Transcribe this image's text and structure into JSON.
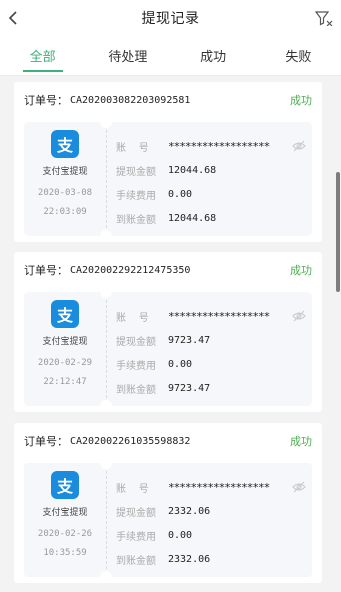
{
  "header": {
    "title": "提现记录"
  },
  "tabs": [
    {
      "label": "全部"
    },
    {
      "label": "待处理"
    },
    {
      "label": "成功"
    },
    {
      "label": "失败"
    }
  ],
  "active_tab": "全部",
  "colors": {
    "accent": "#3fb07a",
    "success": "#4caf50",
    "alipay": "#1a8cde"
  },
  "labels": {
    "order": "订单号：",
    "account": "账    号",
    "amount": "提现金额",
    "fee": "手续费用",
    "received": "到账金额"
  },
  "records": [
    {
      "order_no": "CA202003082203092581",
      "status": "成功",
      "method": "支付宝提现",
      "method_icon": "支",
      "date": "2020-03-08",
      "time": "22:03:09",
      "account": "******************",
      "amount": "12044.68",
      "fee": "0.00",
      "received": "12044.68"
    },
    {
      "order_no": "CA202002292212475350",
      "status": "成功",
      "method": "支付宝提现",
      "method_icon": "支",
      "date": "2020-02-29",
      "time": "22:12:47",
      "account": "******************",
      "amount": "9723.47",
      "fee": "0.00",
      "received": "9723.47"
    },
    {
      "order_no": "CA202002261035598832",
      "status": "成功",
      "method": "支付宝提现",
      "method_icon": "支",
      "date": "2020-02-26",
      "time": "10:35:59",
      "account": "******************",
      "amount": "2332.06",
      "fee": "0.00",
      "received": "2332.06"
    }
  ]
}
